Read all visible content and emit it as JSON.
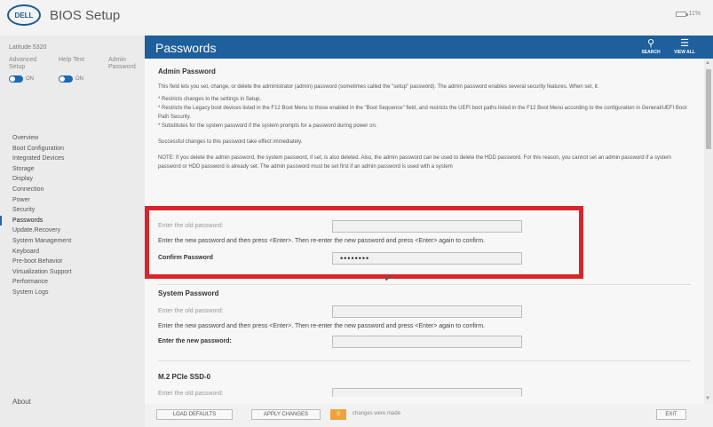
{
  "app": {
    "logo_text": "DELL",
    "title": "BIOS Setup",
    "battery": "11%"
  },
  "sidebar": {
    "model": "Latitude 5320",
    "toggles": [
      {
        "label": "Advanced Setup",
        "state": "ON"
      },
      {
        "label": "Help Text",
        "state": "ON"
      },
      {
        "label": "Admin Password",
        "state": ""
      }
    ],
    "items": [
      "Overview",
      "Boot Configuration",
      "Integrated Devices",
      "Storage",
      "Display",
      "Connection",
      "Power",
      "Security",
      "Passwords",
      "Update,Recovery",
      "System Management",
      "Keyboard",
      "Pre-boot Behavior",
      "Virtualization Support",
      "Performance",
      "System Logs"
    ],
    "active_item": "Passwords",
    "about": "About"
  },
  "header": {
    "title": "Passwords",
    "search_label": "SEARCH",
    "view_all_label": "VIEW ALL"
  },
  "admin": {
    "title": "Admin Password",
    "desc": "This field lets you set, change, or delete the administrator (admin) password (sometimes called the \"setup\" password). The admin password enables several security features. When set, it:",
    "bullets": [
      "* Restricts changes to the settings in Setup.",
      "* Restricts the Legacy boot devices listed in the F12 Boot Menu to those enabled in the \"Boot Sequence\" field, and restricts the UEFI boot paths listed in the F12 Boot Menu according to the configuration in General/UEFI Boot Path Security.",
      "* Substitutes for the system password if the system prompts for a password during power on."
    ],
    "success": "Successful changes to this password take effect immediately.",
    "note": "NOTE: If you delete the admin password, the system password, if set, is also deleted. Also, the admin password can be used to delete the HDD password. For this reason, you cannot set an admin password if a system password or HDD password is already set. The admin password must be set first if an admin password is used with a system",
    "old_label": "Enter the old password:",
    "instruction": "Enter the new password and then press <Enter>. Then re-enter the new password and press <Enter> again to confirm.",
    "confirm_label": "Confirm Password",
    "confirm_value": "••••••••"
  },
  "system_pw": {
    "title": "System Password",
    "old_label": "Enter the old password:",
    "instruction": "Enter the new password and then press <Enter>. Then re-enter the new password and press <Enter> again to confirm.",
    "new_label": "Enter the new password:"
  },
  "ssd": {
    "title": "M.2 PCIe SSD-0",
    "old_label": "Enter the old password:"
  },
  "footer": {
    "load_defaults": "LOAD DEFAULTS",
    "apply_changes": "APPLY CHANGES",
    "changes_count": "0",
    "changes_text": "changes were made",
    "exit": "EXIT"
  },
  "icons": {
    "search": "search-icon",
    "view_all": "view-all-icon",
    "battery": "battery-icon",
    "cursor": "mouse-cursor-icon"
  },
  "colors": {
    "header_blue": "#1e5f9c",
    "toggle_blue": "#1a6ab5",
    "highlight_red": "#d7262b",
    "badge_orange": "#f0a23a"
  }
}
